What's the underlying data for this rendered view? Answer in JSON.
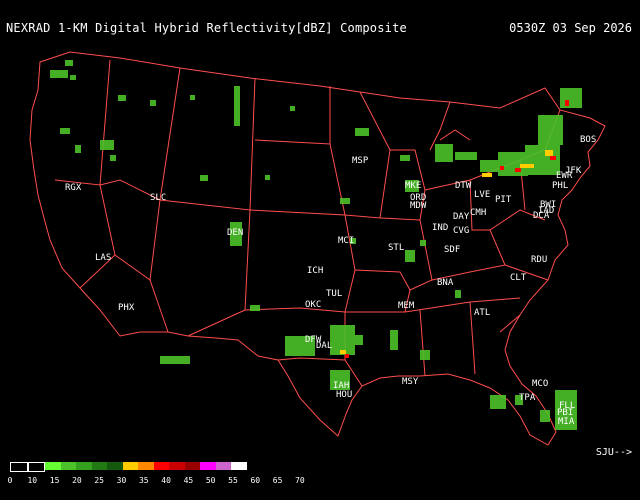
{
  "header": {
    "title": "NEXRAD 1-KM Digital Hybrid Reflectivity[dBZ] Composite",
    "timestamp": "0530Z 03 Sep 2026"
  },
  "map": {
    "border_color": "#ff4d4d",
    "stations": [
      {
        "id": "RGX"
      },
      {
        "id": "SLC"
      },
      {
        "id": "DEN"
      },
      {
        "id": "LAS"
      },
      {
        "id": "PHX"
      },
      {
        "id": "MSP"
      },
      {
        "id": "MKE"
      },
      {
        "id": "ORD"
      },
      {
        "id": "MDW"
      },
      {
        "id": "DTW"
      },
      {
        "id": "LVE"
      },
      {
        "id": "PIT"
      },
      {
        "id": "IAD"
      },
      {
        "id": "DCA"
      },
      {
        "id": "BWI"
      },
      {
        "id": "PHL"
      },
      {
        "id": "EWR"
      },
      {
        "id": "JFK"
      },
      {
        "id": "BOS"
      },
      {
        "id": "MCI"
      },
      {
        "id": "STL"
      },
      {
        "id": "IND"
      },
      {
        "id": "DAY"
      },
      {
        "id": "CMH"
      },
      {
        "id": "CVG"
      },
      {
        "id": "SDF"
      },
      {
        "id": "ICH"
      },
      {
        "id": "TUL"
      },
      {
        "id": "OKC"
      },
      {
        "id": "MEM"
      },
      {
        "id": "BNA"
      },
      {
        "id": "ATL"
      },
      {
        "id": "CLT"
      },
      {
        "id": "RDU"
      },
      {
        "id": "DFW"
      },
      {
        "id": "DAL"
      },
      {
        "id": "IAH"
      },
      {
        "id": "HOU"
      },
      {
        "id": "MSY"
      },
      {
        "id": "MCO"
      },
      {
        "id": "TPA"
      },
      {
        "id": "FLL"
      },
      {
        "id": "PBI"
      },
      {
        "id": "MIA"
      }
    ],
    "inset_label": "SJU-->"
  },
  "legend": {
    "colors": [
      "#000000",
      "#000000",
      "#66ff33",
      "#4cc22a",
      "#35a020",
      "#227a15",
      "#145a0e",
      "#ffcc00",
      "#ff8800",
      "#ff0000",
      "#cc0000",
      "#990000",
      "#ff00ff",
      "#cc66cc",
      "#ffffff"
    ],
    "ticks": [
      "0",
      "10",
      "15",
      "20",
      "25",
      "30",
      "35",
      "40",
      "45",
      "50",
      "55",
      "60",
      "65",
      "70"
    ]
  }
}
